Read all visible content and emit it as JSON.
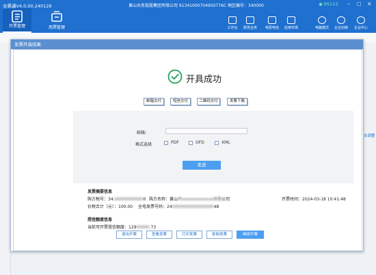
{
  "app": {
    "title": "全票通V4.0.00.240129",
    "company_line": "黄山水务投股集团有限公司 91341000704950776C 地区编号：340000",
    "ip_value": "95113"
  },
  "main_tabs": [
    {
      "label": "开票管理"
    },
    {
      "label": "用票管理"
    }
  ],
  "toolbar": [
    {
      "label": "工作台",
      "icon": "desk-icon"
    },
    {
      "label": "财务业务",
      "icon": "finance-icon"
    },
    {
      "label": "电票电信",
      "icon": "e-invoice-icon"
    },
    {
      "label": "应用市场",
      "icon": "market-icon"
    }
  ],
  "right_toolbar": [
    {
      "label": "电脑模式",
      "icon": "desktop-mode-icon"
    },
    {
      "label": "企业切换",
      "icon": "switch-company-icon"
    },
    {
      "label": "企业中心",
      "icon": "enterprise-center-icon"
    }
  ],
  "side_link": "去调整",
  "modal": {
    "title": "发票开具结果",
    "success_text": "开具成功",
    "delivery_buttons": [
      "邮箱交付",
      "短信交付",
      "二维码交付",
      "发票下载"
    ],
    "email_label": "邮箱：",
    "email_value": "",
    "format_label": "格式选择",
    "formats": [
      {
        "label": "PDF",
        "checked": false
      },
      {
        "label": "OFD",
        "checked": false
      },
      {
        "label": "XML",
        "checked": false
      }
    ],
    "send_label": "发送",
    "summary_title": "发票摘要信息",
    "buyer_tax_prefix": "购方税号：34.",
    "buyer_tax_blur": "00000000000",
    "buyer_tax_suffix": "0",
    "buyer_name_prefix": "购方名称：黄山",
    "buyer_name_blur": "市xxxxxxxxxxxxx有限",
    "buyer_name_suffix": "公司",
    "issue_time": "开票时间：2024-03-18 10:41:48",
    "total_label": "价税合计（元）：100.00",
    "invoice_no_prefix": "全电发票号码：24",
    "invoice_no_blur": "0000000000000000",
    "invoice_no_suffix": "48",
    "credit_title": "授信额度信息",
    "quota_prefix": "当前可开票授信额度：129",
    "quota_blur": "00000.",
    "quota_suffix": "73",
    "bottom_buttons": [
      "退出开票",
      "查看发票",
      "打印发票",
      "复制发票",
      "继续开票"
    ]
  },
  "colors": {
    "topbar": "#1f70cf",
    "primary_button": "#4c9ef0",
    "success_green": "#27a05b"
  }
}
